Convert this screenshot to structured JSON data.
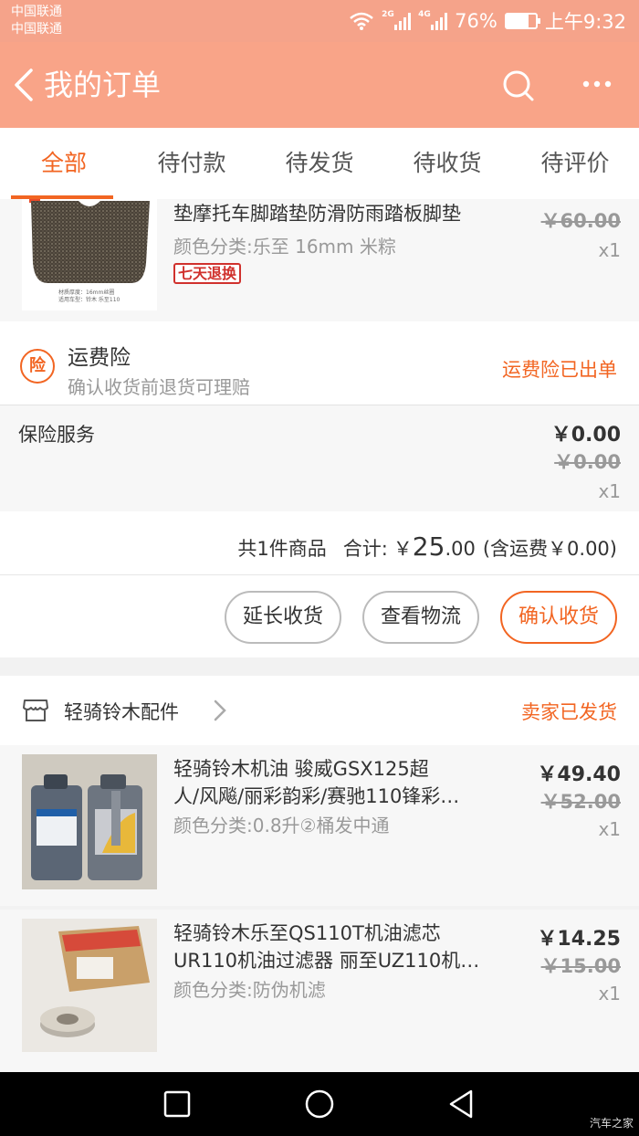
{
  "status_bar": {
    "carrier_1": "中国联通",
    "carrier_2": "中国联通",
    "net_1": "2G",
    "net_2": "4G",
    "battery": "76%",
    "battery_level": 0.76,
    "time": "上午9:32"
  },
  "header": {
    "title": "我的订单"
  },
  "tabs": [
    {
      "label": "全部",
      "active": true
    },
    {
      "label": "待付款"
    },
    {
      "label": "待发货"
    },
    {
      "label": "待收货"
    },
    {
      "label": "待评价"
    }
  ],
  "order1": {
    "item": {
      "title": "垫摩托车脚踏垫防滑防雨踏板脚垫",
      "spec": "颜色分类:乐至 16mm 米粽",
      "badge": "七天退换",
      "price_original": "￥60.00",
      "qty": "x1",
      "image_caption_1": "材质厚度：16mm丝圈",
      "image_caption_2": "适用车型：铃木 乐至110"
    },
    "insurance": {
      "icon_char": "险",
      "title": "运费险",
      "subtitle": "确认收货前退货可理赔",
      "status": "运费险已出单"
    },
    "service": {
      "label": "保险服务",
      "price": "￥0.00",
      "price_original": "￥0.00",
      "qty": "x1"
    },
    "summary": {
      "count_text": "共1件商品",
      "total_label": "合计:",
      "currency": "￥",
      "total_int": "25",
      "total_dec": ".00",
      "shipping_note": "(含运费￥0.00)"
    },
    "actions": {
      "extend": "延长收货",
      "logistics": "查看物流",
      "confirm": "确认收货"
    }
  },
  "order2": {
    "shop_name": "轻骑铃木配件",
    "status": "卖家已发货",
    "items": [
      {
        "title_line1": "轻骑铃木机油 骏威GSX125超",
        "title_line2": "人/风飚/丽彩韵彩/赛驰110锋彩…",
        "spec": "颜色分类:0.8升②桶发中通",
        "price": "￥49.40",
        "price_original": "￥52.00",
        "qty": "x1"
      },
      {
        "title_line1": "轻骑铃木乐至QS110T机油滤芯",
        "title_line2": "UR110机油过滤器 丽至UZ110机…",
        "spec": "颜色分类:防伪机滤",
        "price": "￥14.25",
        "price_original": "￥15.00",
        "qty": "x1"
      }
    ]
  },
  "watermark": "汽车之家",
  "colors": {
    "accent": "#f26522",
    "header_bg": "#f9a488"
  }
}
